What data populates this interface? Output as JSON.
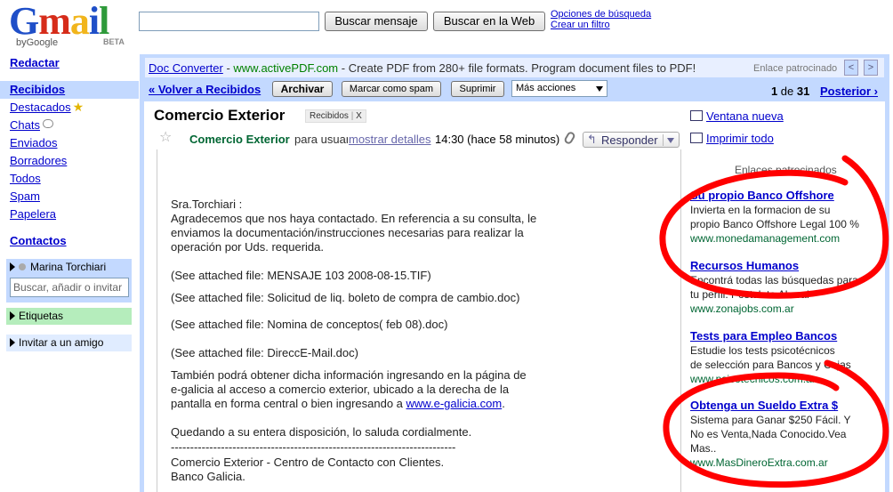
{
  "logo": {
    "text": "Gmail",
    "by": "byGoogle",
    "beta": "BETA"
  },
  "search": {
    "search_mail_label": "Buscar mensaje",
    "search_web_label": "Buscar en la Web",
    "options_link": "Opciones de búsqueda",
    "filter_link": "Crear un filtro"
  },
  "nav": {
    "compose": "Redactar",
    "items": [
      "Recibidos",
      "Destacados",
      "Chats",
      "Enviados",
      "Borradores",
      "Todos",
      "Spam",
      "Papelera"
    ],
    "contacts": "Contactos",
    "chat_user": "Marina Torchiari",
    "chat_search_placeholder": "Buscar, añadir o invitar",
    "labels": "Etiquetas",
    "invite": "Invitar a un amigo"
  },
  "ad_bar": {
    "title": "Doc Converter",
    "url": "www.activePDF.com",
    "text": "- Create PDF from 280+ file formats. Program document files to PDF!",
    "sponsored": "Enlace patrocinado",
    "prev": "<",
    "next": ">"
  },
  "toolbar": {
    "back": "« Volver a Recibidos",
    "archive": "Archivar",
    "spam": "Marcar como spam",
    "delete": "Suprimir",
    "more_actions": "Más acciones",
    "pager_current": "1",
    "pager_of": "de",
    "pager_total": "31",
    "next": "Posterior ›"
  },
  "message": {
    "subject": "Comercio Exterior",
    "label": "Recibidos",
    "label_close": "X",
    "sender": "Comercio Exterior",
    "to": "para usuario",
    "details": "mostrar detalles",
    "time": "14:30 (hace 58 minutos)",
    "reply": "Responder",
    "body": {
      "greeting": "Sra.Torchiari :",
      "p1": [
        "Agradecemos que nos haya contactado. En referencia a su consulta, le",
        "enviamos la documentación/instrucciones necesarias para realizar la",
        "operación por Uds. requerida."
      ],
      "att1": "(See attached file: MENSAJE 103  2008-08-15.TIF)",
      "att2": "(See attached file: Solicitud de liq. boleto de compra de cambio.doc)",
      "att3": "(See attached file: Nomina de conceptos( feb 08).doc)",
      "att4": "(See attached file: DireccE-Mail.doc)",
      "p2": [
        "También podrá obtener dicha información ingresando en la página de",
        "e-galicia al acceso a comercio exterior, ubicado a la derecha de la"
      ],
      "p2_last": "pantalla en forma central o bien ingresando a",
      "p2_link": "www.e-galicia.com",
      "p2_end": ".",
      "closing": "Quedando a su entera disposición, lo saluda cordialmente.",
      "rule": "------------------------------------------------------------------------------------------",
      "sig1": "Comercio Exterior - Centro de Contacto con Clientes.",
      "sig2": "Banco Galicia."
    }
  },
  "side": {
    "new_window": "Ventana nueva",
    "print_all": "Imprimir todo",
    "ads_title": "Enlaces patrocinados",
    "ads": [
      {
        "title": "Su propio Banco Offshore",
        "lines": [
          "Invierta en la formacion de su",
          "propio Banco Offshore Legal 100 %"
        ],
        "url": "www.monedamanagement.com"
      },
      {
        "title": "Recursos Humanos",
        "lines": [
          "Encontrá todas las búsquedas para",
          "tu perfil. Postulate Ahora!"
        ],
        "url": "www.zonajobs.com.ar"
      },
      {
        "title": "Tests para Empleo Bancos",
        "lines": [
          "Estudie los tests psicotécnicos",
          "de selección para Bancos y Cajas"
        ],
        "url": "www.psicotecnicos.com.ar"
      },
      {
        "title": "Obtenga un Sueldo Extra $",
        "lines": [
          "Sistema para Ganar $250 Fácil. Y",
          "No es Venta,Nada Conocido.Vea",
          "Mas.."
        ],
        "url": "www.MasDineroExtra.com.ar"
      }
    ]
  }
}
